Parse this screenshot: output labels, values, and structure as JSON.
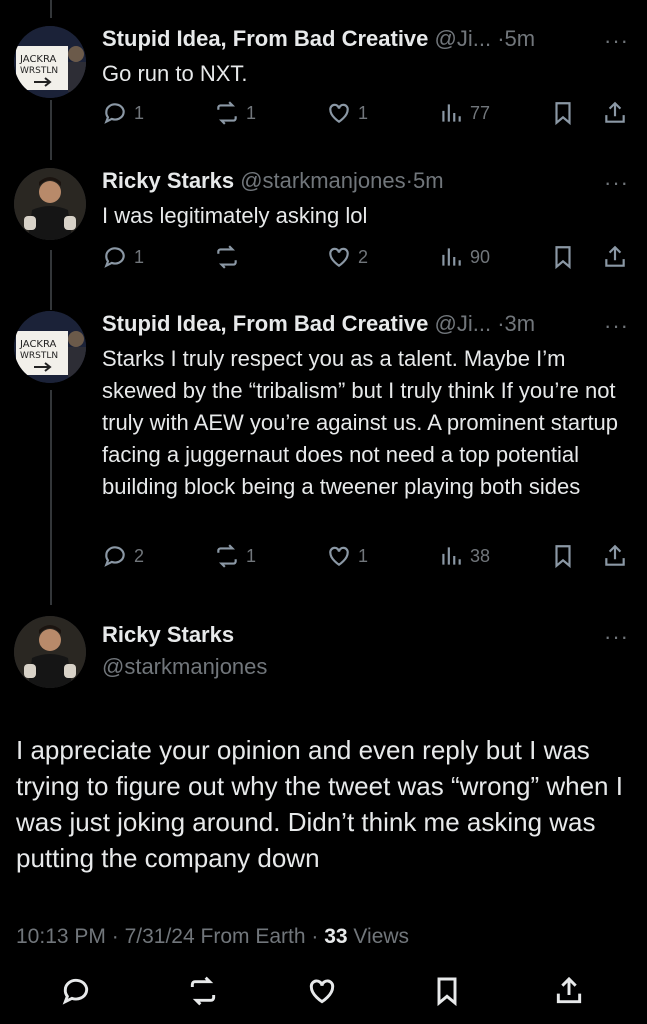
{
  "tweets": [
    {
      "name": "Stupid Idea, From Bad Creative",
      "handle": "@Ji...",
      "sep": "·",
      "time": "5m",
      "text": "Go run to NXT.",
      "replies": "1",
      "reposts": "1",
      "likes": "1",
      "views": "77",
      "more": "···",
      "avatar": "sign-avatar"
    },
    {
      "name": "Ricky Starks",
      "handle": "@starkmanjones",
      "sep": "·",
      "time": "5m",
      "text": "I was legitimately asking lol",
      "replies": "1",
      "reposts": "",
      "likes": "2",
      "views": "90",
      "more": "···",
      "avatar": "wrestler-avatar"
    },
    {
      "name": "Stupid Idea, From Bad Creative",
      "handle": "@Ji...",
      "sep": "·",
      "time": "3m",
      "text": "Starks I truly respect you as a talent. Maybe I’m skewed by the “tribalism” but I truly think If you’re not truly with AEW you’re against us.  A prominent startup facing a juggernaut does not need a top potential building block being a tweener playing both sides",
      "replies": "2",
      "reposts": "1",
      "likes": "1",
      "views": "38",
      "more": "···",
      "avatar": "sign-avatar"
    }
  ],
  "main_tweet": {
    "name": "Ricky Starks",
    "handle": "@starkmanjones",
    "more": "···",
    "text": "I appreciate your opinion and even reply but I was trying to figure out why the tweet was “wrong” when I was just joking around. Didn’t think me asking was putting the company down",
    "time": "10:13 PM",
    "date": "7/31/24",
    "source": "From Earth",
    "sep": "·",
    "views_count": "33",
    "views_label": "Views"
  },
  "colors": {
    "background": "#000000",
    "text": "#e7e9ea",
    "muted": "#71767b",
    "thread_line": "#333639"
  },
  "icons": [
    "reply-icon",
    "repost-icon",
    "like-icon",
    "views-icon",
    "bookmark-icon",
    "share-icon",
    "more-icon"
  ]
}
